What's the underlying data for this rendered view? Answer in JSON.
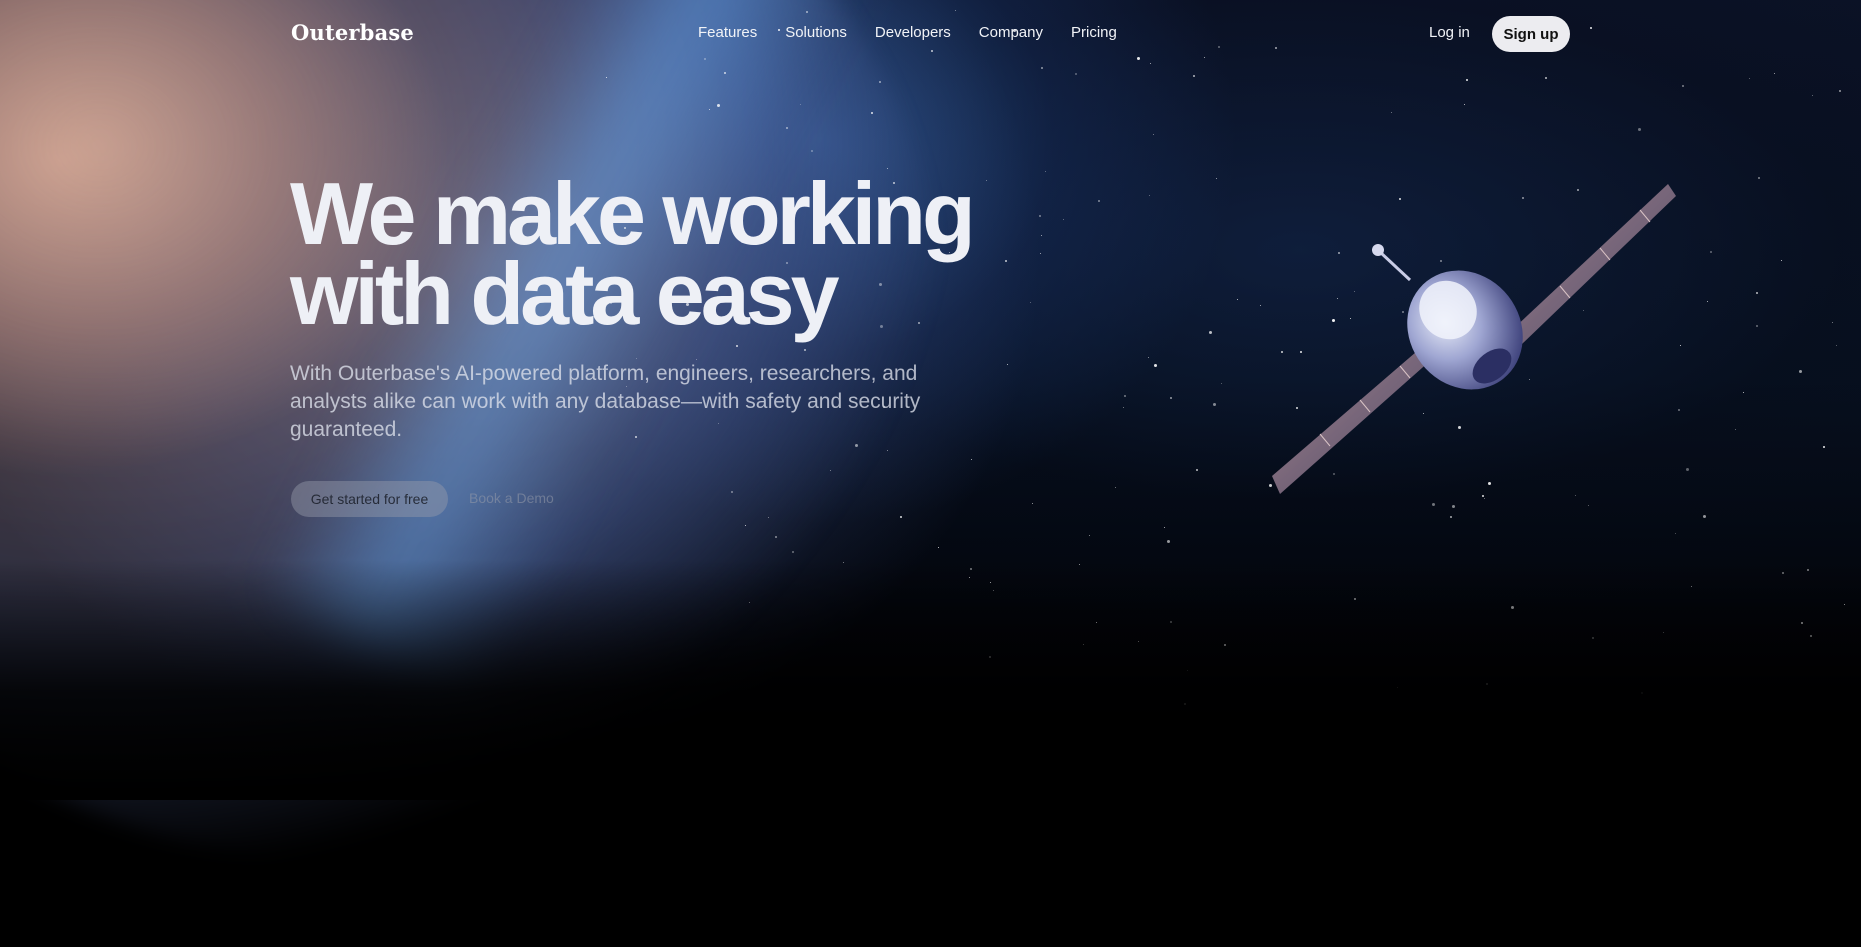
{
  "nav": {
    "logo": "Outerbase",
    "links": [
      "Features",
      "Solutions",
      "Developers",
      "Company",
      "Pricing"
    ],
    "login_label": "Log in",
    "signup_label": "Sign up"
  },
  "hero": {
    "title_line1": "We make working",
    "title_line2": "with data easy",
    "subtitle": "With Outerbase's AI-powered platform, engineers, researchers, and analysts alike can work with any database—with safety and security guaranteed.",
    "primary_cta": "Get started for free",
    "secondary_cta": "Book a Demo"
  },
  "illustration": {
    "background": "earth-from-orbit",
    "object": "satellite-icon"
  },
  "colors": {
    "background": "#000000",
    "signup_bg": "#ececf0",
    "title_text": "#eef0f6"
  }
}
